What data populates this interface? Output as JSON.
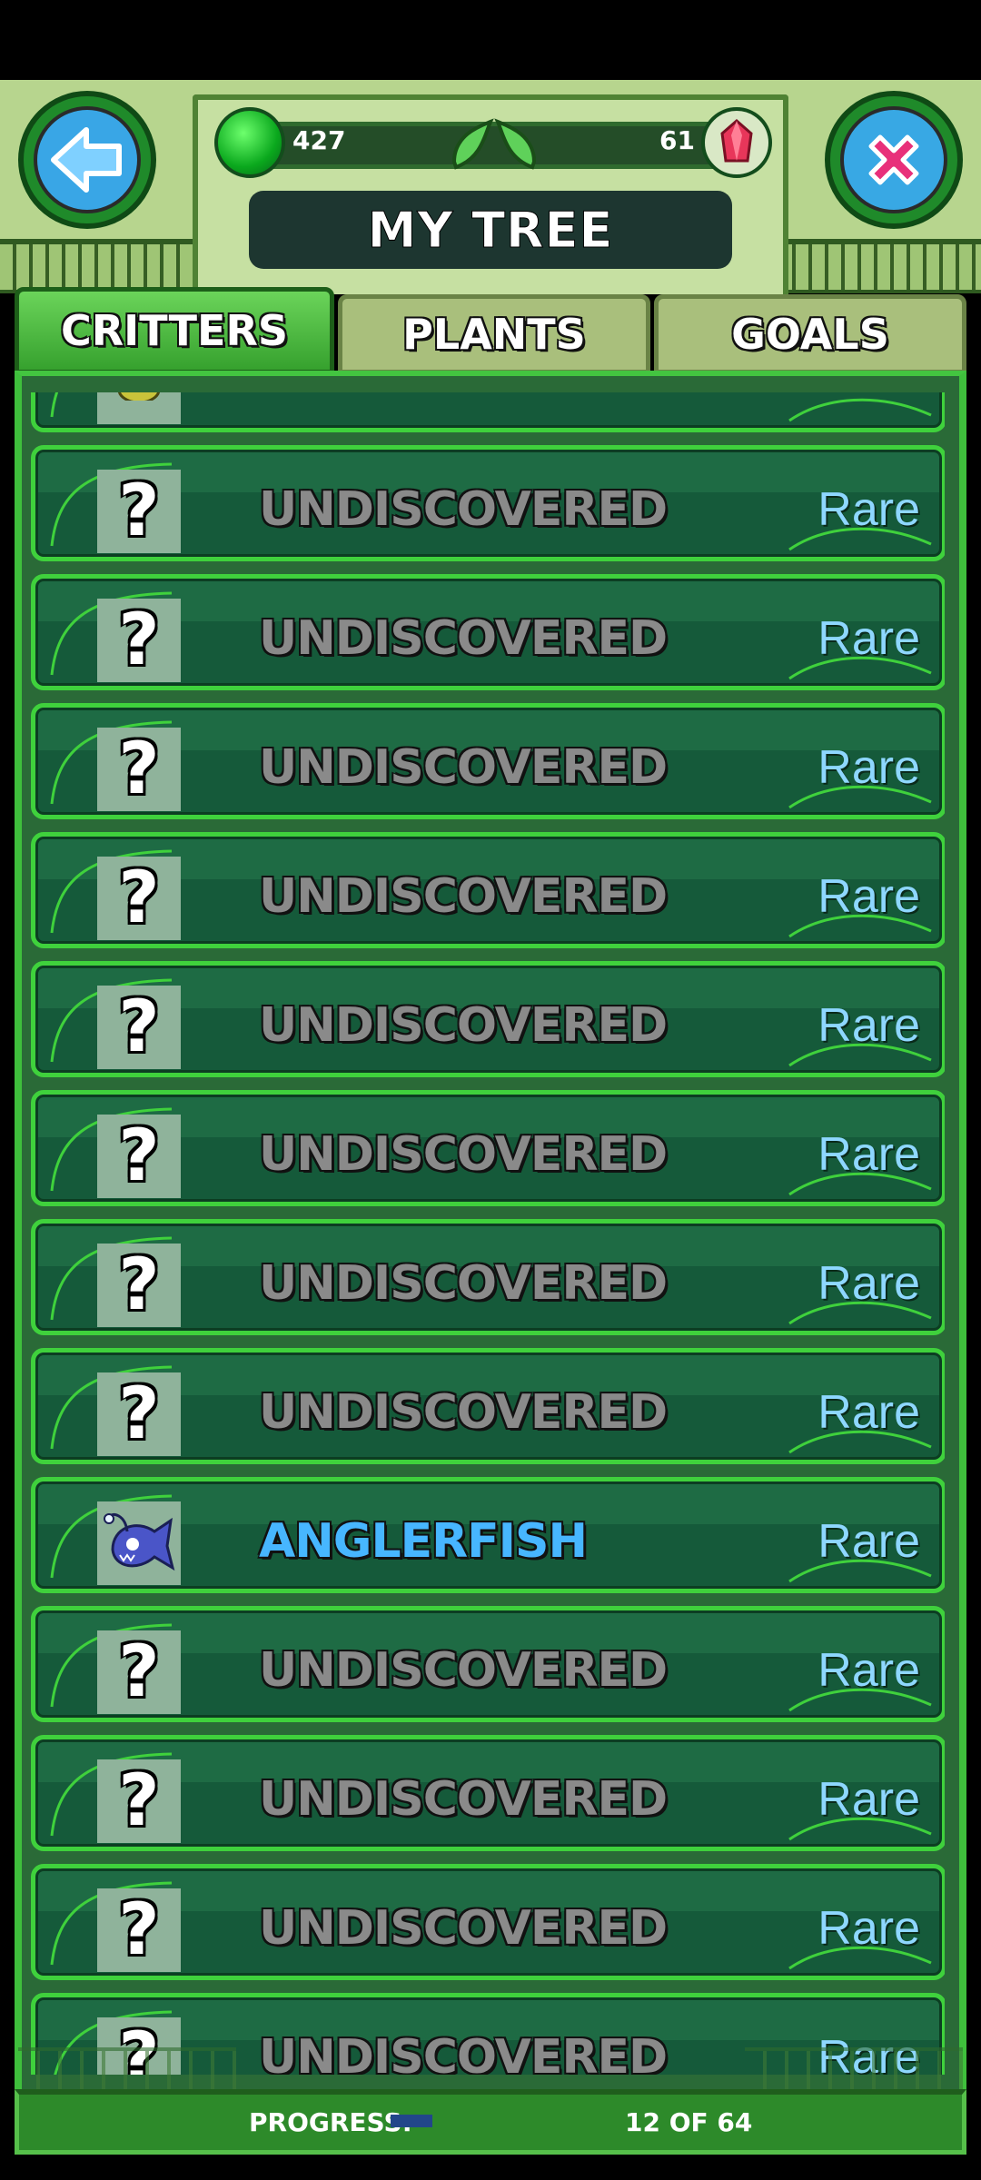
{
  "header": {
    "title": "MY TREE",
    "gem_count": "427",
    "crystal_count": "61"
  },
  "tabs": [
    {
      "label": "CRITTERS",
      "active": true
    },
    {
      "label": "PLANTS",
      "active": false
    },
    {
      "label": "GOALS",
      "active": false
    }
  ],
  "critters": [
    {
      "name": "",
      "rarity": "",
      "discovered": true
    },
    {
      "name": "UNDISCOVERED",
      "rarity": "Rare",
      "discovered": false
    },
    {
      "name": "UNDISCOVERED",
      "rarity": "Rare",
      "discovered": false
    },
    {
      "name": "UNDISCOVERED",
      "rarity": "Rare",
      "discovered": false
    },
    {
      "name": "UNDISCOVERED",
      "rarity": "Rare",
      "discovered": false
    },
    {
      "name": "UNDISCOVERED",
      "rarity": "Rare",
      "discovered": false
    },
    {
      "name": "UNDISCOVERED",
      "rarity": "Rare",
      "discovered": false
    },
    {
      "name": "UNDISCOVERED",
      "rarity": "Rare",
      "discovered": false
    },
    {
      "name": "UNDISCOVERED",
      "rarity": "Rare",
      "discovered": false
    },
    {
      "name": "ANGLERFISH",
      "rarity": "Rare",
      "discovered": true
    },
    {
      "name": "UNDISCOVERED",
      "rarity": "Rare",
      "discovered": false
    },
    {
      "name": "UNDISCOVERED",
      "rarity": "Rare",
      "discovered": false
    },
    {
      "name": "UNDISCOVERED",
      "rarity": "Rare",
      "discovered": false
    },
    {
      "name": "UNDISCOVERED",
      "rarity": "Rare",
      "discovered": false
    }
  ],
  "progress": {
    "label": "PROGRESS:",
    "count_text": "12 OF 64",
    "value": 0.1875
  },
  "colors": {
    "panel_border": "#3fd13c",
    "undiscovered_text": "#8a8a8a",
    "discovered_text": "#47b6ff",
    "rarity_text": "#8ed7ff"
  }
}
